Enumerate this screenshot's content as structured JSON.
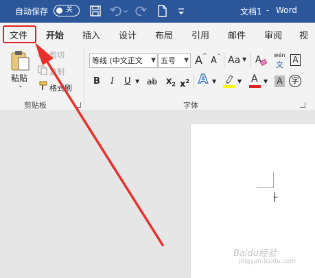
{
  "titlebar": {
    "autosave_label": "自动保存",
    "autosave_state": "关",
    "doc_name": "文档1",
    "separator": "-",
    "app_name": "Word",
    "save_icon": "save-icon",
    "undo_icon": "undo-icon",
    "redo_icon": "redo-icon",
    "new_icon": "new-document-icon",
    "customize_icon": "customize-toolbar-icon"
  },
  "tabs": [
    {
      "label": "文件"
    },
    {
      "label": "开始"
    },
    {
      "label": "插入"
    },
    {
      "label": "设计"
    },
    {
      "label": "布局"
    },
    {
      "label": "引用"
    },
    {
      "label": "邮件"
    },
    {
      "label": "审阅"
    },
    {
      "label": "视图"
    }
  ],
  "clipboard": {
    "paste_label": "粘贴",
    "cut_label": "剪切",
    "copy_label": "复制",
    "format_painter_label": "格式刷",
    "group_label": "剪贴板"
  },
  "font": {
    "font_name": "等线 (中文正文",
    "font_size": "五号",
    "grow_font": "A",
    "shrink_font": "A",
    "change_case": "Aa",
    "phonetic_top": "wén",
    "phonetic_bottom": "文",
    "char_border": "A",
    "bold": "B",
    "italic": "I",
    "underline": "U",
    "strikethrough": "ab",
    "subscript": "x",
    "subscript_mark": "2",
    "superscript": "x",
    "superscript_mark": "2",
    "text_effects": "A",
    "font_color": "A",
    "char_shading": "A",
    "enclose_char": "字",
    "group_label": "字体"
  },
  "colors": {
    "titlebar": "#2b579a",
    "highlight_red": "#e02020",
    "font_color_bar": "#e02020",
    "highlight_bar": "#ffff00"
  },
  "watermark": {
    "line1": "Baidu经验",
    "line2": "jingyan.baidu.com"
  }
}
